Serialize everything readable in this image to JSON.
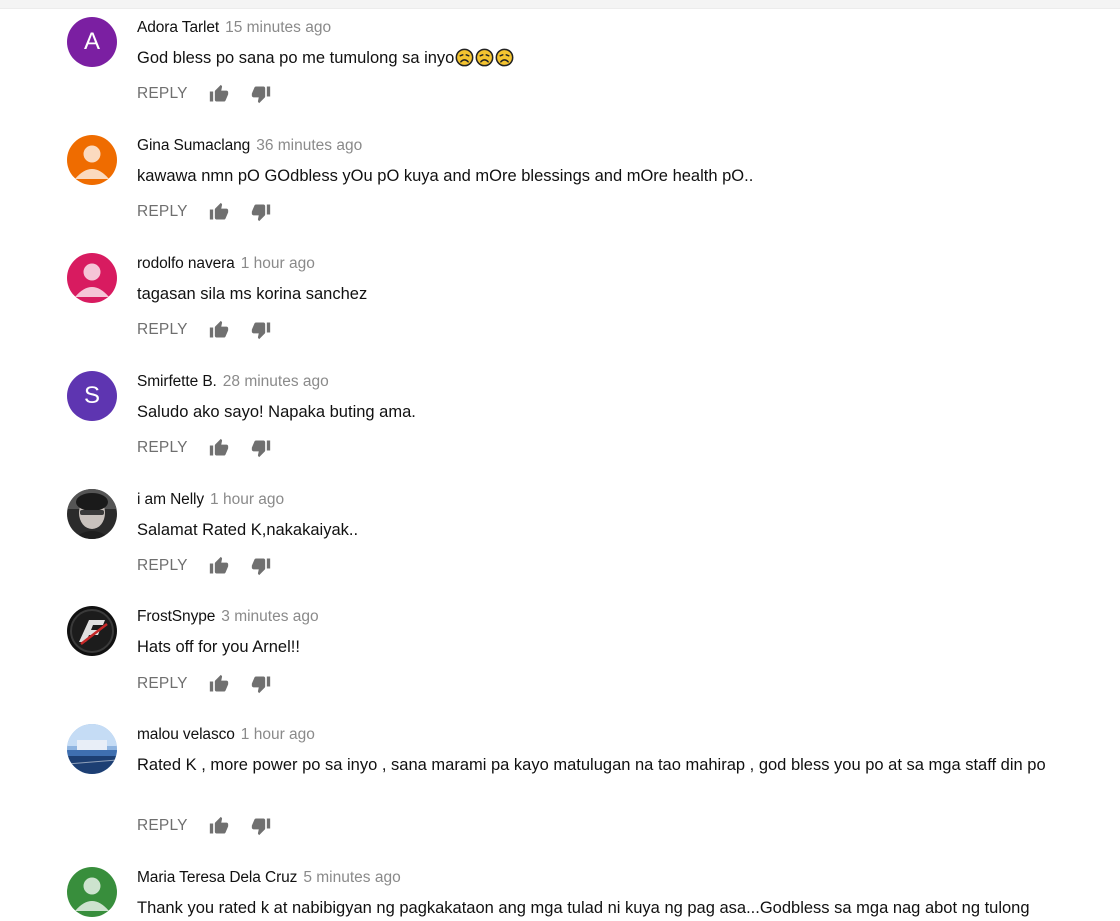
{
  "reply_label": "REPLY",
  "colors": {
    "author": "#111111",
    "timestamp": "#8a8a8a",
    "action": "#6f6f6f"
  },
  "comments": [
    {
      "author": "Adora Tarlet",
      "time": "15 minutes ago",
      "text": "God bless po sana po me tumulong sa inyo",
      "emoji_count": 3,
      "avatar": {
        "type": "letter",
        "letter": "A",
        "color": "#7b1fa2"
      }
    },
    {
      "author": "Gina Sumaclang",
      "time": "36 minutes ago",
      "text": "kawawa nmn pO GOdbless yOu pO kuya and mOre blessings and mOre health pO..",
      "avatar": {
        "type": "default",
        "color": "#ef6c00"
      }
    },
    {
      "author": "rodolfo navera",
      "time": "1 hour ago",
      "text": "tagasan sila ms korina sanchez",
      "avatar": {
        "type": "default",
        "color": "#d81b60"
      }
    },
    {
      "author": "Smirfette B.",
      "time": "28 minutes ago",
      "text": "Saludo ako sayo! Napaka buting ama.",
      "avatar": {
        "type": "letter",
        "letter": "S",
        "color": "#5e35b1"
      }
    },
    {
      "author": "i am Nelly",
      "time": "1 hour ago",
      "text": "Salamat Rated K,nakakaiyak..",
      "avatar": {
        "type": "photo"
      }
    },
    {
      "author": "FrostSnype",
      "time": "3 minutes ago",
      "text": "Hats off for you Arnel!!",
      "avatar": {
        "type": "logo"
      }
    },
    {
      "author": "malou velasco",
      "time": "1 hour ago",
      "text": "Rated K , more power po sa inyo , sana marami pa kayo matulugan na tao mahirap , god bless you po at sa mga staff din po",
      "avatar": {
        "type": "landscape"
      }
    },
    {
      "author": "Maria Teresa Dela Cruz",
      "time": "5 minutes ago",
      "text": "Thank you rated k at nabibigyan ng pagkakataon ang mga tulad ni kuya ng pag asa...Godbless sa mga nag abot ng tulong",
      "avatar": {
        "type": "default",
        "color": "#388e3c"
      }
    }
  ]
}
